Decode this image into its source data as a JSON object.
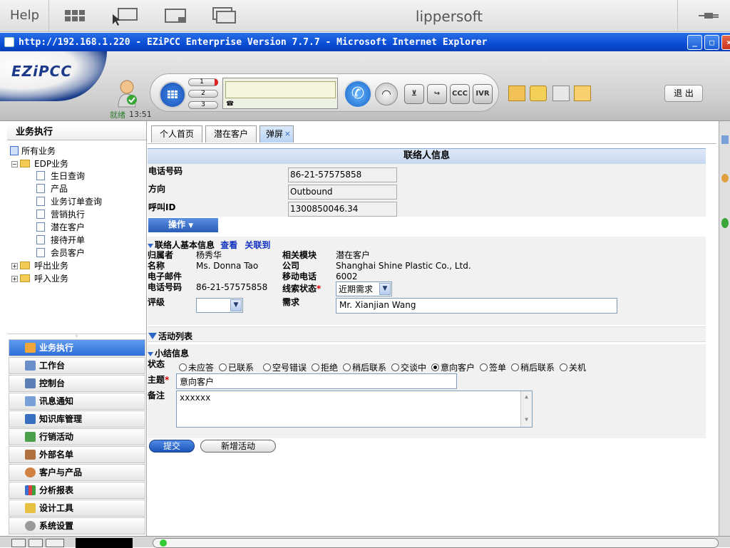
{
  "vnc": {
    "help": "Help",
    "title": "lippersoft"
  },
  "browser": {
    "title": "http://192.168.1.220 - EZiPCC Enterprise Version 7.7.7 - Microsoft Internet Explorer"
  },
  "app": {
    "logo": "EZiPCC",
    "status": "就绪",
    "time": "13:51",
    "lines": [
      "1",
      "2",
      "3"
    ],
    "buttons": {
      "ccc": "CCC",
      "ivr": "IVR"
    },
    "logout": "退 出"
  },
  "sidebar": {
    "title": "业务执行",
    "root": "所有业务",
    "edp": "EDP业务",
    "items": [
      "生日查询",
      "产品",
      "业务订单查询",
      "营销执行",
      "潜在客户",
      "接待开单",
      "会员客户"
    ],
    "groups": [
      "呼出业务",
      "呼入业务"
    ],
    "menu": [
      "业务执行",
      "工作台",
      "控制台",
      "讯息通知",
      "知识库管理",
      "行销活动",
      "外部名单",
      "客户与产品",
      "分析报表",
      "设计工具",
      "系统设置"
    ]
  },
  "tabs": [
    "个人首页",
    "潜在客户",
    "弹屏"
  ],
  "contact_info": {
    "title": "联络人信息",
    "phone_label": "电话号码",
    "phone": "86-21-57575858",
    "direction_label": "方向",
    "direction": "Outbound",
    "callid_label": "呼叫ID",
    "callid": "1300850046.34",
    "action": "操作"
  },
  "basic": {
    "title": "联络人基本信息",
    "view": "查看",
    "link": "关联到",
    "owner_label": "归属者",
    "owner": "杨秀华",
    "module_label": "相关模块",
    "module": "潜在客户",
    "name_label": "名称",
    "name": "Ms. Donna Tao",
    "company_label": "公司",
    "company": "Shanghai Shine Plastic Co., Ltd.",
    "email_label": "电子邮件",
    "mobile_label": "移动电话",
    "mobile": "6002",
    "phone_label": "电话号码",
    "phone": "86-21-57575858",
    "lead_status_label": "线索状态",
    "required_mark": "*",
    "lead_status": "近期需求",
    "rating_label": "评级",
    "rating": "",
    "need_label": "需求",
    "need": "Mr. Xianjian Wang"
  },
  "activity": {
    "title": "活动列表"
  },
  "summary": {
    "title": "小结信息",
    "status_label": "状态",
    "options": [
      "未应答",
      "已联系",
      "空号错误",
      "拒绝",
      "稍后联系",
      "交谈中",
      "意向客户",
      "签单",
      "稍后联系",
      "关机"
    ],
    "selected": 6,
    "subject_label": "主题",
    "subject": "意向客户",
    "note_label": "备注",
    "note": "xxxxxx"
  },
  "actions": {
    "submit": "提交",
    "new_activity": "新增活动"
  }
}
